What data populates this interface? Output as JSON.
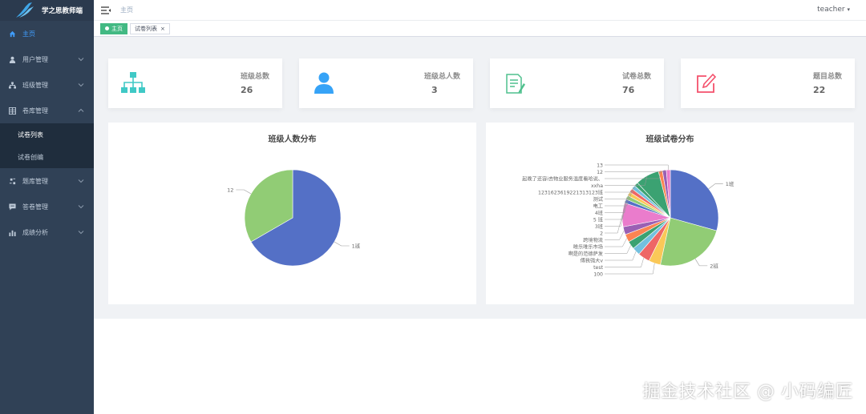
{
  "app": {
    "title": "学之思教师端"
  },
  "sidebar": {
    "items": [
      {
        "label": "主页",
        "icon": "home-icon",
        "active": true
      },
      {
        "label": "用户管理",
        "icon": "user-icon"
      },
      {
        "label": "班级管理",
        "icon": "org-icon"
      },
      {
        "label": "卷库管理",
        "icon": "table-icon",
        "expanded": true,
        "children": [
          "试卷列表",
          "试卷创编"
        ]
      },
      {
        "label": "题库管理",
        "icon": "question-icon"
      },
      {
        "label": "答卷管理",
        "icon": "answer-icon"
      },
      {
        "label": "成绩分析",
        "icon": "chart-icon"
      }
    ]
  },
  "navbar": {
    "breadcrumb": "主页",
    "user": "teacher"
  },
  "tags": [
    {
      "label": "主页",
      "active": true
    },
    {
      "label": "试卷列表",
      "active": false,
      "close": "×"
    }
  ],
  "cards": [
    {
      "label": "班级总数",
      "value": "26",
      "color": "#40c9c6",
      "icon": "sitemap-icon"
    },
    {
      "label": "班级总人数",
      "value": "3",
      "color": "#36a3f7",
      "icon": "person-icon"
    },
    {
      "label": "试卷总数",
      "value": "76",
      "color": "#4fc08d",
      "icon": "paper-icon"
    },
    {
      "label": "题目总数",
      "value": "22",
      "color": "#f4516c",
      "icon": "edit-icon"
    }
  ],
  "chart_data": [
    {
      "type": "pie",
      "title": "班级人数分布",
      "categories": [
        "1班",
        "12"
      ],
      "values": [
        2,
        1
      ],
      "colors": [
        "#5470c6",
        "#91cc75"
      ]
    },
    {
      "type": "pie",
      "title": "班级试卷分布",
      "categories": [
        "1班",
        "2班",
        "100",
        "test",
        "傅我强大v",
        "啊是的范德萨发",
        "唯乐唯乐市场",
        "跨境物流",
        "2",
        "3班",
        "5 班",
        "4班",
        "电工",
        "测试",
        "1231623619221313123班",
        "xxha",
        "起晚了还容i去物业服务温度看哈说、",
        "12",
        "13"
      ],
      "values": [
        22,
        18,
        3,
        3,
        2,
        2,
        2,
        2,
        6,
        1,
        1,
        1,
        1,
        1,
        1,
        6,
        1,
        1,
        1
      ],
      "colors": [
        "#5470c6",
        "#91cc75",
        "#fac858",
        "#ee6666",
        "#73c0de",
        "#3ba272",
        "#fc8452",
        "#9a60b4",
        "#ea7ccc",
        "#5470c6",
        "#91cc75",
        "#fac858",
        "#ee6666",
        "#73c0de",
        "#3ba272",
        "#3ba272",
        "#fc8452",
        "#9a60b4",
        "#ea7ccc"
      ]
    }
  ],
  "watermark": "掘金技术社区 @ 小码编匠"
}
